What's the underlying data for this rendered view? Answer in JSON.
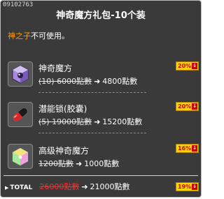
{
  "header": {
    "item_id": "09102763",
    "title": "神奇魔方礼包-10个装"
  },
  "notice": {
    "highlight": "神之子",
    "text": "不可使用。"
  },
  "items": [
    {
      "name": "神奇魔方",
      "old_price": "(10) 6000點數",
      "new_price": "4800點數",
      "badge": "20%",
      "icon": "mystic-cube-icon"
    },
    {
      "name": "潜能锁(胶囊)",
      "old_price": "(5) 19000點數",
      "new_price": "15200點數",
      "badge": "20%",
      "icon": "potential-lock-capsule-icon"
    },
    {
      "name": "高级神奇魔方",
      "old_price": "1200點數",
      "new_price": "1000點數",
      "badge": "16%",
      "icon": "advanced-cube-icon"
    }
  ],
  "total": {
    "label": "TOTAL",
    "old_price": "26000點數",
    "new_price": "21000點數",
    "badge": "19%"
  },
  "arrow_symbol": "➜",
  "down_symbol": "↓",
  "colors": {
    "background": "#3a3a3a",
    "highlight": "#ff9a00",
    "badge_bg": "#ffd200",
    "badge_text": "#d00000"
  }
}
